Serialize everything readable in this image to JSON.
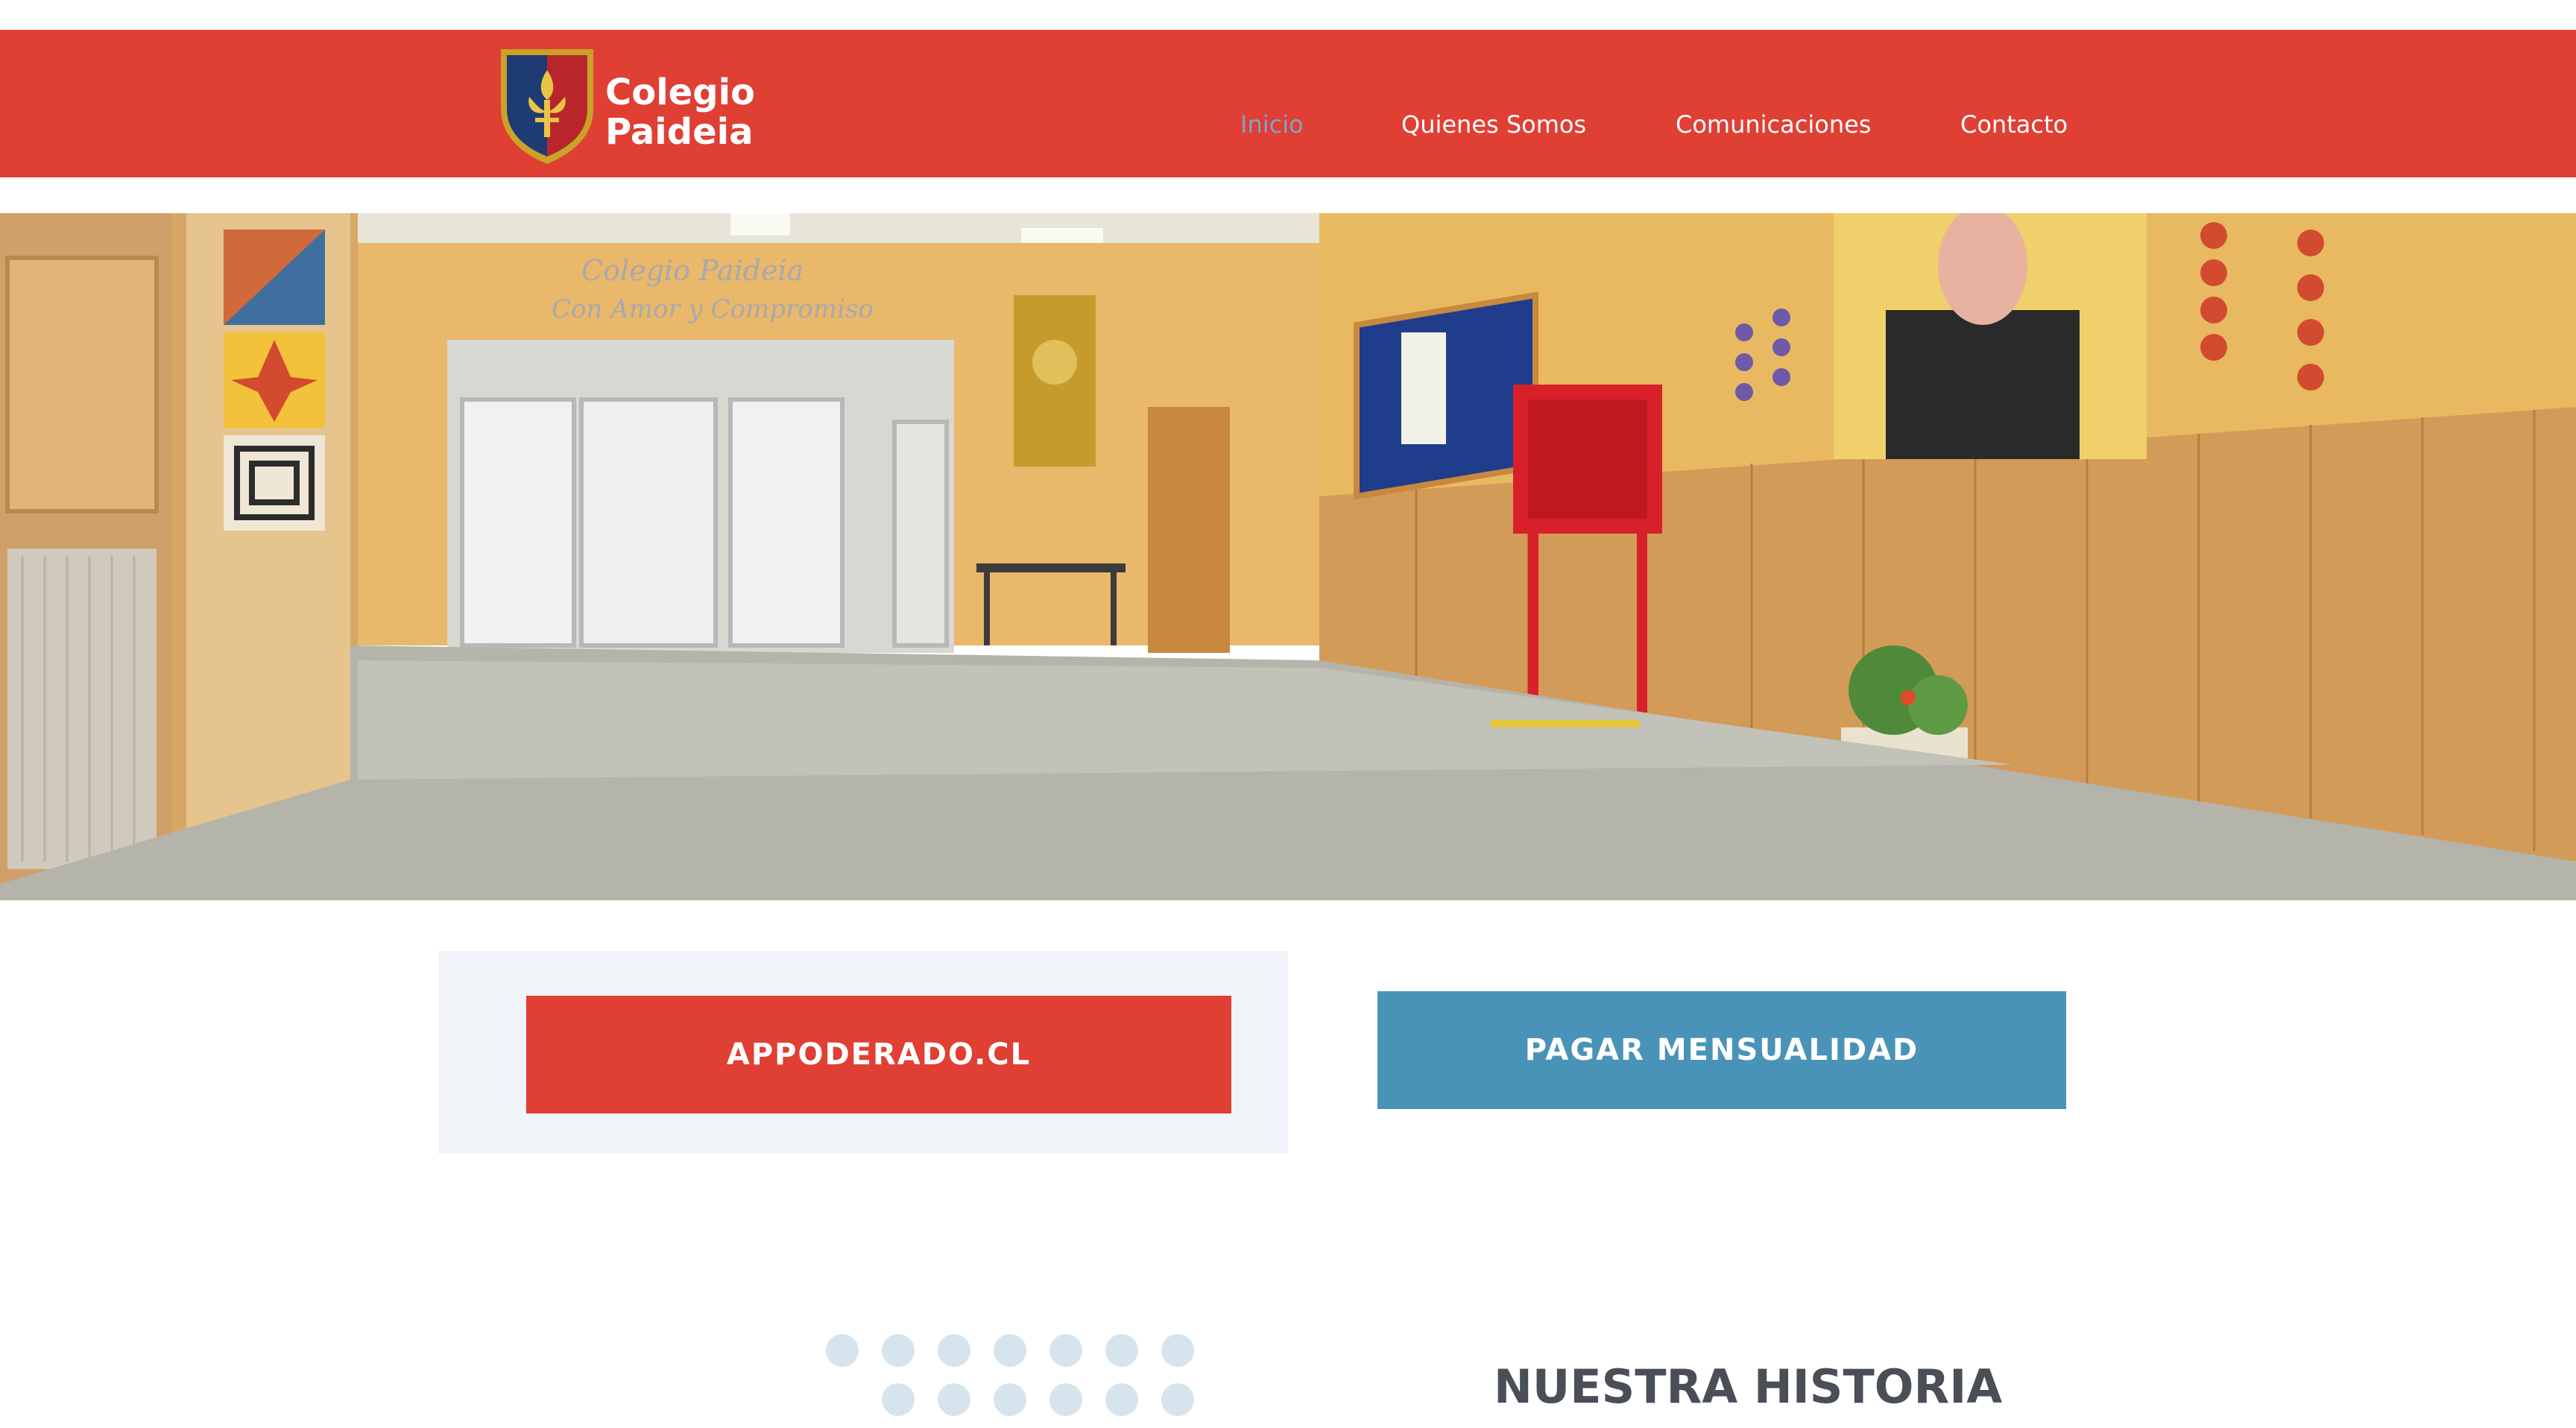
{
  "brand": {
    "line1": "Colegio",
    "line2": "Paideia",
    "crest_icon": "school-crest-icon"
  },
  "nav": {
    "items": [
      {
        "label": "Inicio",
        "active": true
      },
      {
        "label": "Quienes Somos",
        "active": false
      },
      {
        "label": "Comunicaciones",
        "active": false
      },
      {
        "label": "Contacto",
        "active": false
      }
    ]
  },
  "actions": {
    "appoderado_label": "APPODERADO.CL",
    "pagar_label": "PAGAR MENSUALIDAD"
  },
  "history": {
    "title": "NUESTRA HISTORIA"
  },
  "colors": {
    "brand_red": "#e03f34",
    "accent_blue": "#4a93b8",
    "active_nav": "#7fa3c6",
    "panel_bg": "#f1f4f8",
    "dots": "#d6e4ee"
  }
}
